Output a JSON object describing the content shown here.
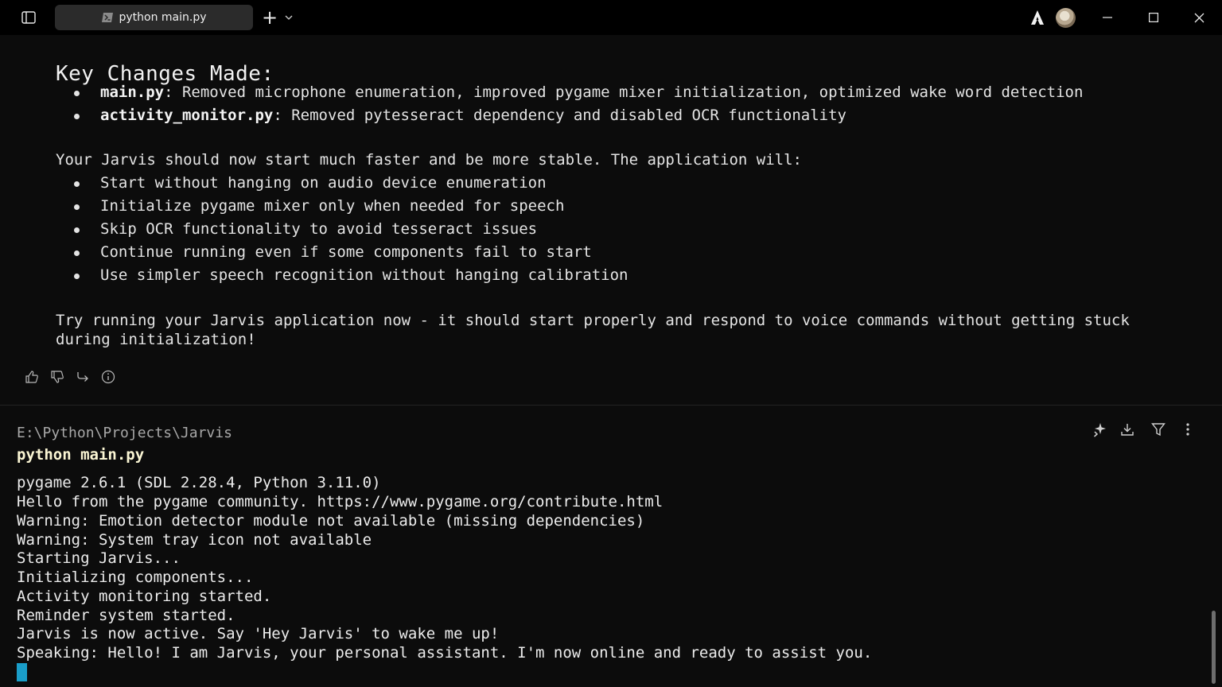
{
  "window": {
    "tab_title": "python main.py",
    "new_tab_symbol": "+",
    "icons": [
      "sidebar-toggle-icon",
      "terminal-icon",
      "plus-icon",
      "chevron-down-icon",
      "agent-logo-icon",
      "avatar",
      "minimize-icon",
      "maximize-icon",
      "close-icon"
    ]
  },
  "response": {
    "heading": "Key Changes Made:",
    "changes": [
      {
        "file": "main.py",
        "text": ": Removed microphone enumeration, improved pygame mixer initialization, optimized wake word detection"
      },
      {
        "file": "activity_monitor.py",
        "text": ": Removed pytesseract dependency and disabled OCR functionality"
      }
    ],
    "summary_intro": "Your Jarvis should now start much faster and be more stable. The application will:",
    "benefits": [
      "Start without hanging on audio device enumeration",
      "Initialize pygame mixer only when needed for speech",
      "Skip OCR functionality to avoid tesseract issues",
      "Continue running even if some components fail to start",
      "Use simpler speech recognition without hanging calibration"
    ],
    "closing_line1": "Try running your Jarvis application now - it should start properly and respond to voice commands without getting stuck",
    "closing_line2": "during initialization!",
    "feedback_icons": [
      "thumbs-up-icon",
      "thumbs-down-icon",
      "share-icon",
      "info-icon"
    ]
  },
  "terminal": {
    "cwd": "E:\\Python\\Projects\\Jarvis",
    "command": "python main.py",
    "toolbar_icons": [
      "sparkle-icon",
      "download-icon",
      "filter-icon",
      "more-icon"
    ],
    "output": [
      "pygame 2.6.1 (SDL 2.28.4, Python 3.11.0)",
      "Hello from the pygame community. https://www.pygame.org/contribute.html",
      "Warning: Emotion detector module not available (missing dependencies)",
      "Warning: System tray icon not available",
      "Starting Jarvis...",
      "Initializing components...",
      "Activity monitoring started.",
      "Reminder system started.",
      "Jarvis is now active. Say 'Hey Jarvis' to wake me up!",
      "Speaking: Hello! I am Jarvis, your personal assistant. I'm now online and ready to assist you."
    ]
  },
  "colors": {
    "background": "#0c0c0c",
    "command": "#fbf6d4",
    "cursor": "#1a9ec9",
    "muted": "#a8a8a8"
  }
}
